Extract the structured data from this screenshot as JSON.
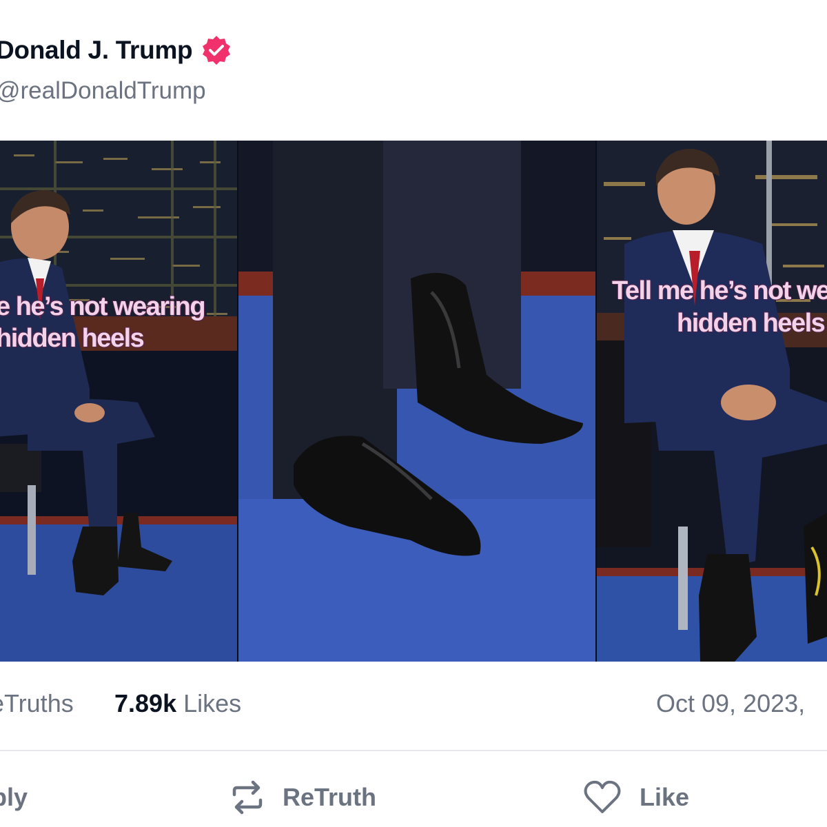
{
  "post": {
    "author_name": "Donald J. Trump",
    "handle": "@realDonaldTrump",
    "verified_badge_icon": "verified-badge-icon",
    "accent_color": "#f0316b"
  },
  "media": {
    "panels": [
      {
        "overlay_lines": [
          "e he’s not wearing",
          "hidden heels"
        ]
      },
      {
        "overlay_lines": []
      },
      {
        "overlay_lines": [
          "Tell me he’s not we",
          "hidden heels"
        ]
      }
    ]
  },
  "stats": {
    "retruths_label": "eTruths",
    "likes_count": "7.89k",
    "likes_label": "Likes",
    "date": "Oct 09, 2023,"
  },
  "actions": {
    "reply_label": "ply",
    "retruth_label": "ReTruth",
    "like_label": "Like"
  }
}
